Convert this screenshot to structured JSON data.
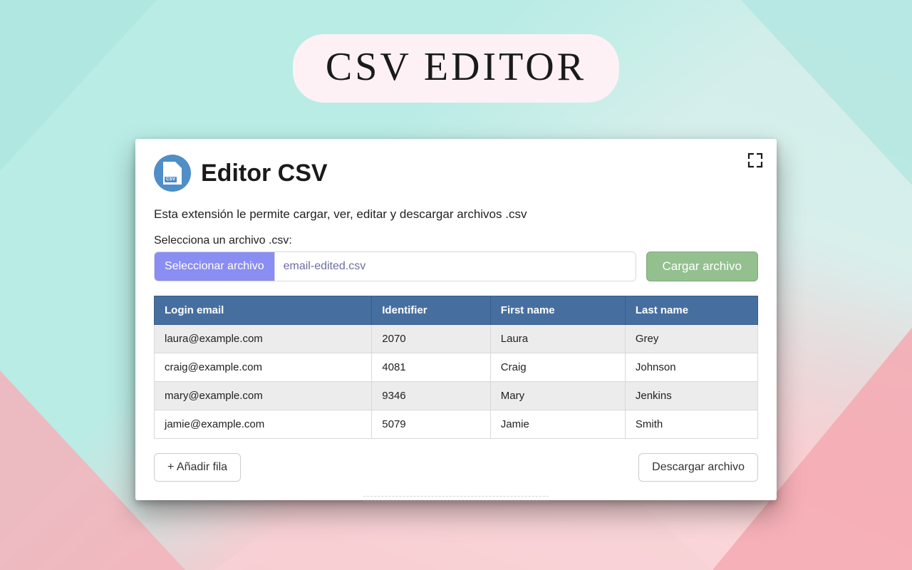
{
  "banner": {
    "title": "CSV EDITOR"
  },
  "panel": {
    "logo_tag": "CSV",
    "title": "Editor CSV",
    "description": "Esta extensión le permite cargar, ver, editar y descargar archivos .csv",
    "picker_label": "Selecciona un archivo .csv:",
    "select_button": "Seleccionar archivo",
    "filename": "email-edited.csv",
    "load_button": "Cargar archivo",
    "add_row_button": "+ Añadir fila",
    "download_button": "Descargar archivo"
  },
  "table": {
    "headers": [
      "Login email",
      "Identifier",
      "First name",
      "Last name"
    ],
    "rows": [
      [
        "laura@example.com",
        "2070",
        "Laura",
        "Grey"
      ],
      [
        "craig@example.com",
        "4081",
        "Craig",
        "Johnson"
      ],
      [
        "mary@example.com",
        "9346",
        "Mary",
        "Jenkins"
      ],
      [
        "jamie@example.com",
        "5079",
        "Jamie",
        "Smith"
      ]
    ]
  }
}
